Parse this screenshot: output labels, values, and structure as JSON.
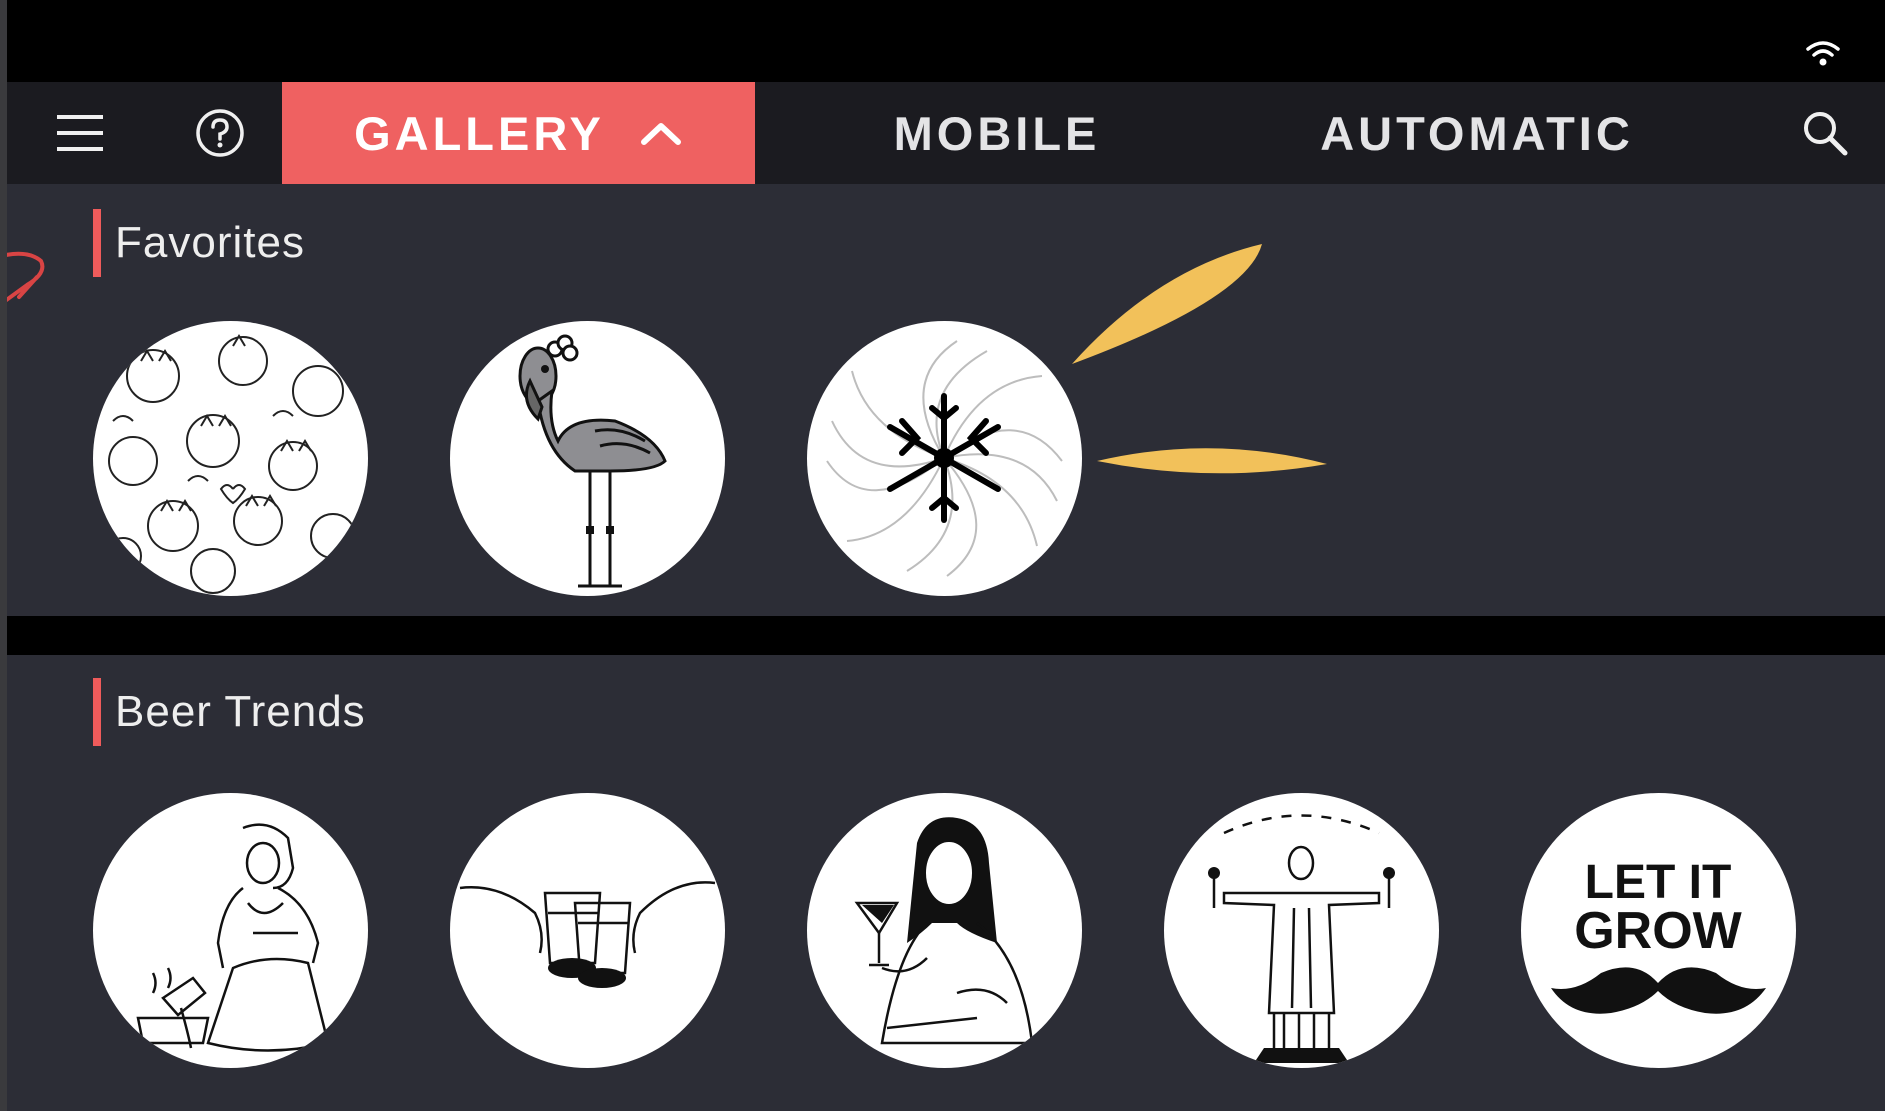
{
  "status_bar": {
    "wifi_icon": "wifi-icon"
  },
  "nav": {
    "menu_icon": "hamburger-menu-icon",
    "help_icon": "help-circle-icon",
    "tabs": [
      {
        "label": "GALLERY",
        "active": true,
        "icon": "chevron-up-icon"
      },
      {
        "label": "MOBILE",
        "active": false
      },
      {
        "label": "AUTOMATIC",
        "active": false
      }
    ],
    "search_icon": "search-icon",
    "active_color": "#ef6161"
  },
  "sections": [
    {
      "title": "Favorites",
      "items": [
        "cats-pattern",
        "flamingo",
        "snowflake-spiral"
      ]
    },
    {
      "title": "Beer Trends",
      "items": [
        "milkmaid-pouring",
        "hands-toasting",
        "mona-lisa-wine",
        "christ-redeemer",
        "let-it-grow-mustache"
      ]
    }
  ],
  "thumbnail_text": {
    "let_it": "LET IT",
    "grow": "GROW"
  },
  "accent_colors": {
    "section_bar": "#ef5b5b",
    "feather": "#f2c15a"
  }
}
